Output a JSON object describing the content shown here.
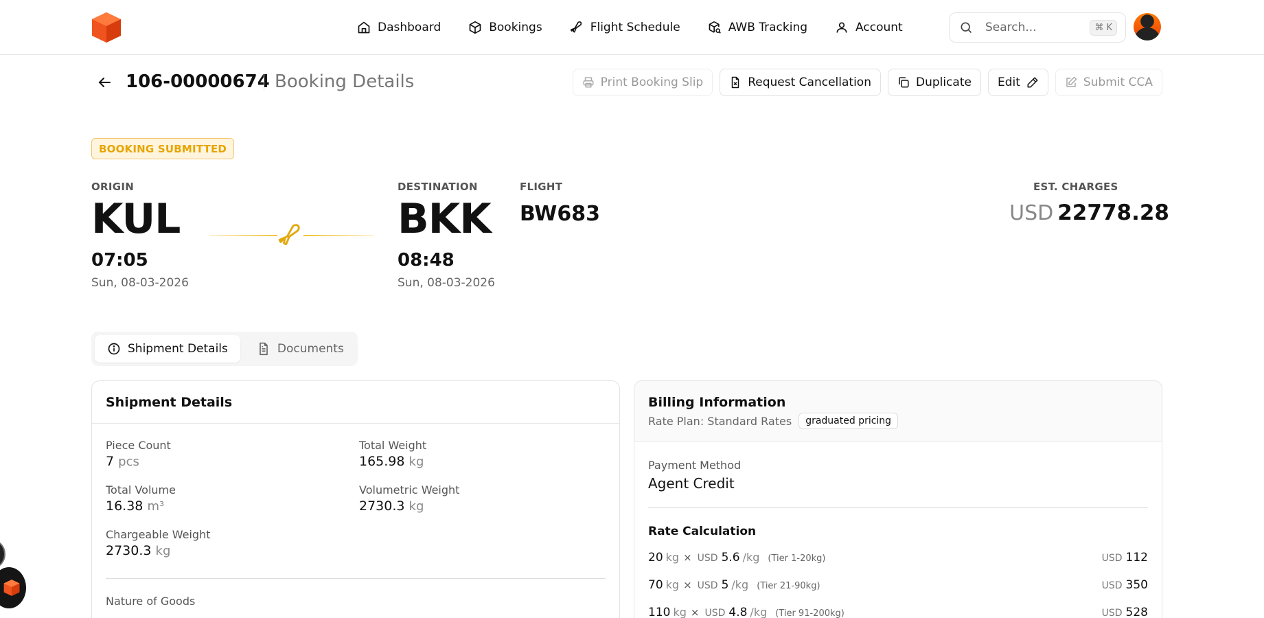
{
  "nav": {
    "items": [
      {
        "label": "Dashboard",
        "icon": "home-icon"
      },
      {
        "label": "Bookings",
        "icon": "box-icon"
      },
      {
        "label": "Flight Schedule",
        "icon": "plane-icon"
      },
      {
        "label": "AWB Tracking",
        "icon": "package-search-icon"
      },
      {
        "label": "Account",
        "icon": "user-icon"
      }
    ],
    "search_placeholder": "Search...",
    "search_shortcut": "⌘ K"
  },
  "header": {
    "booking_id": "106-00000674",
    "title": "Booking Details",
    "actions": {
      "print": "Print Booking Slip",
      "cancel": "Request Cancellation",
      "duplicate": "Duplicate",
      "edit": "Edit",
      "cca": "Submit CCA"
    }
  },
  "status": "BOOKING SUBMITTED",
  "route": {
    "origin_label": "ORIGIN",
    "origin_code": "KUL",
    "origin_time": "07:05",
    "origin_date": "Sun, 08-03-2026",
    "destination_label": "DESTINATION",
    "destination_code": "BKK",
    "destination_time": "08:48",
    "destination_date": "Sun, 08-03-2026",
    "flight_label": "FLIGHT",
    "flight": "BW683",
    "charges_label": "EST. CHARGES",
    "charges_currency": "USD",
    "charges_amount": "22778.28"
  },
  "tabs": [
    {
      "label": "Shipment Details",
      "active": true
    },
    {
      "label": "Documents",
      "active": false
    }
  ],
  "shipment": {
    "title": "Shipment Details",
    "piece_count_label": "Piece Count",
    "piece_count": "7",
    "piece_unit": "pcs",
    "total_weight_label": "Total Weight",
    "total_weight": "165.98",
    "weight_unit": "kg",
    "total_volume_label": "Total Volume",
    "total_volume": "16.38",
    "volume_unit": "m³",
    "volumetric_weight_label": "Volumetric Weight",
    "volumetric_weight": "2730.3",
    "chargeable_weight_label": "Chargeable Weight",
    "chargeable_weight": "2730.3",
    "nature_of_goods_label": "Nature of Goods"
  },
  "billing": {
    "title": "Billing Information",
    "rate_plan": "Rate Plan: Standard Rates",
    "pricing_pill": "graduated pricing",
    "payment_method_label": "Payment Method",
    "payment_method": "Agent Credit",
    "rate_calc_title": "Rate Calculation",
    "rows": [
      {
        "qty": "20",
        "unit": "kg",
        "cur": "USD",
        "rate": "5.6",
        "per": "/kg",
        "tier": "(Tier 1-20kg)",
        "total_cur": "USD",
        "total": "112"
      },
      {
        "qty": "70",
        "unit": "kg",
        "cur": "USD",
        "rate": "5",
        "per": "/kg",
        "tier": "(Tier 21-90kg)",
        "total_cur": "USD",
        "total": "350"
      },
      {
        "qty": "110",
        "unit": "kg",
        "cur": "USD",
        "rate": "4.8",
        "per": "/kg",
        "tier": "(Tier 91-200kg)",
        "total_cur": "USD",
        "total": "528"
      }
    ]
  },
  "colors": {
    "brand": "#f0541e",
    "status_bg": "#fff5df",
    "status_text": "#e7a500",
    "route_accent": "#efc02c"
  }
}
